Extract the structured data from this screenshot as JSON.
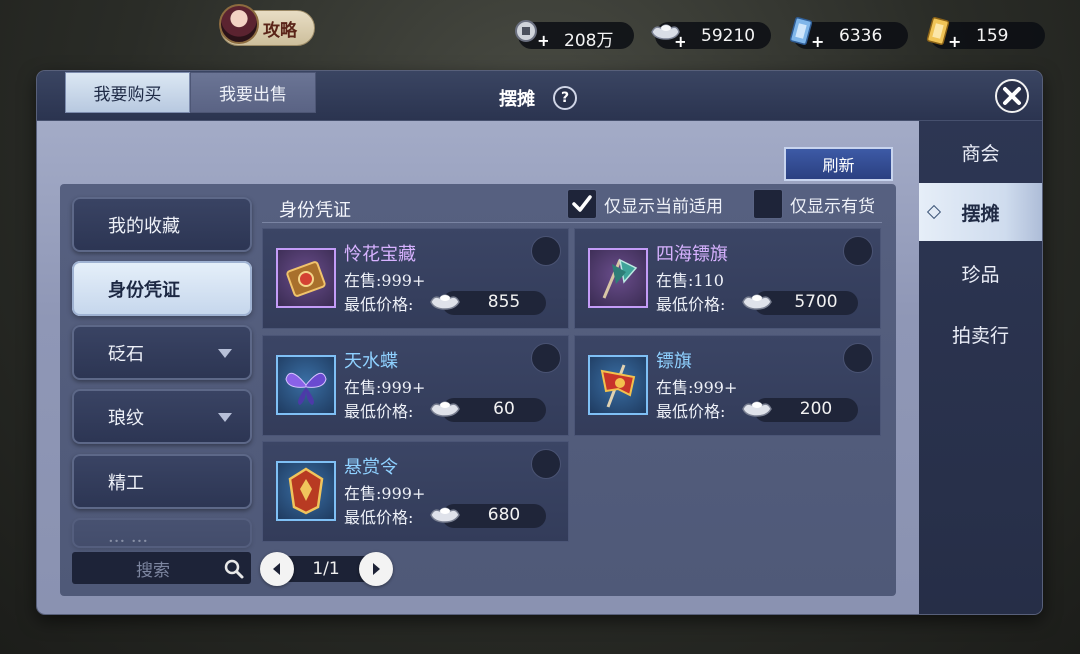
{
  "top_bar": {
    "guide_label": "攻略",
    "currencies": [
      {
        "icon": "coin-pile-add-icon",
        "value": "208万"
      },
      {
        "icon": "silver-ingot-add-icon",
        "value": "59210"
      },
      {
        "icon": "blue-ticket-add-icon",
        "value": "6336"
      },
      {
        "icon": "gold-ticket-add-icon",
        "value": "159"
      }
    ]
  },
  "window": {
    "title": "摆摊",
    "help_symbol": "?"
  },
  "tabs": [
    {
      "label": "我要购买",
      "active": true
    },
    {
      "label": "我要出售",
      "active": false
    }
  ],
  "refresh_label": "刷新",
  "categories": [
    {
      "label": "我的收藏",
      "active": false,
      "expandable": false
    },
    {
      "label": "身份凭证",
      "active": true,
      "expandable": false
    },
    {
      "label": "砭石",
      "active": false,
      "expandable": true
    },
    {
      "label": "琅纹",
      "active": false,
      "expandable": true
    },
    {
      "label": "精工",
      "active": false,
      "expandable": false
    },
    {
      "label": "··· ···",
      "active": false,
      "expandable": false
    }
  ],
  "search": {
    "placeholder": "搜索"
  },
  "pager": {
    "text": "1/1"
  },
  "listing": {
    "section_title": "身份凭证",
    "filter_current": {
      "label": "仅显示当前适用",
      "checked": true
    },
    "filter_in_stock": {
      "label": "仅显示有货",
      "checked": false
    },
    "stock_prefix": "在售:",
    "price_label": "最低价格:",
    "items": [
      {
        "name": "怜花宝藏",
        "stock": "999+",
        "price": "855",
        "rarity": "purple",
        "icon": "treasure-chest-icon"
      },
      {
        "name": "四海镖旗",
        "stock": "110",
        "price": "5700",
        "rarity": "purple",
        "icon": "escort-flag-icon"
      },
      {
        "name": "天水蝶",
        "stock": "999+",
        "price": "60",
        "rarity": "blue",
        "icon": "butterfly-icon"
      },
      {
        "name": "镖旗",
        "stock": "999+",
        "price": "200",
        "rarity": "blue",
        "icon": "red-banner-icon"
      },
      {
        "name": "悬赏令",
        "stock": "999+",
        "price": "680",
        "rarity": "blue",
        "icon": "bounty-token-icon"
      }
    ]
  },
  "side_nav": [
    {
      "label": "商会",
      "active": false
    },
    {
      "label": "摆摊",
      "active": true
    },
    {
      "label": "珍品",
      "active": false
    },
    {
      "label": "拍卖行",
      "active": false
    }
  ]
}
